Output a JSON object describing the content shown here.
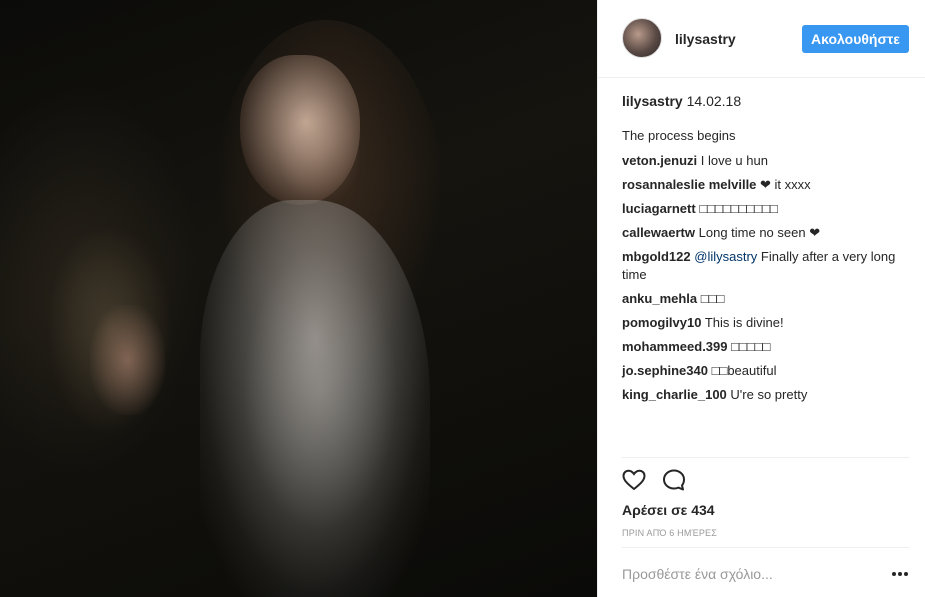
{
  "post": {
    "author": "lilysastry",
    "follow_label": "Ακολουθήστε",
    "caption": {
      "user": "lilysastry",
      "date": "14.02.18"
    },
    "description": "The process begins",
    "comments": [
      {
        "user": "veton.jenuzi",
        "text": "I love u hun"
      },
      {
        "user": "rosannaleslie melville",
        "text": "❤ it xxxx"
      },
      {
        "user": "luciagarnett",
        "text": "□□□□□□□□□□"
      },
      {
        "user": "callewaertw",
        "text": "Long time no seen ❤"
      },
      {
        "user": "mbgold122",
        "mention": "@lilysastry",
        "text": "Finally after a very long time"
      },
      {
        "user": "anku_mehla",
        "text": "□□□"
      },
      {
        "user": "pomogilvy10",
        "text": "This is divine!"
      },
      {
        "user": "mohammeed.399",
        "text": "□□□□□"
      },
      {
        "user": "jo.sephine340",
        "text": "□□beautiful"
      },
      {
        "user": "king_charlie_100",
        "text": "U're so pretty"
      }
    ],
    "likes": "Αρέσει σε 434",
    "time_ago": "ΠΡΙΝ ΑΠΌ 6 ΗΜΈΡΕΣ",
    "add_comment_placeholder": "Προσθέστε ένα σχόλιο..."
  },
  "icons": {
    "like": "heart-icon",
    "comment": "comment-bubble-icon",
    "more": "more-options-icon"
  }
}
